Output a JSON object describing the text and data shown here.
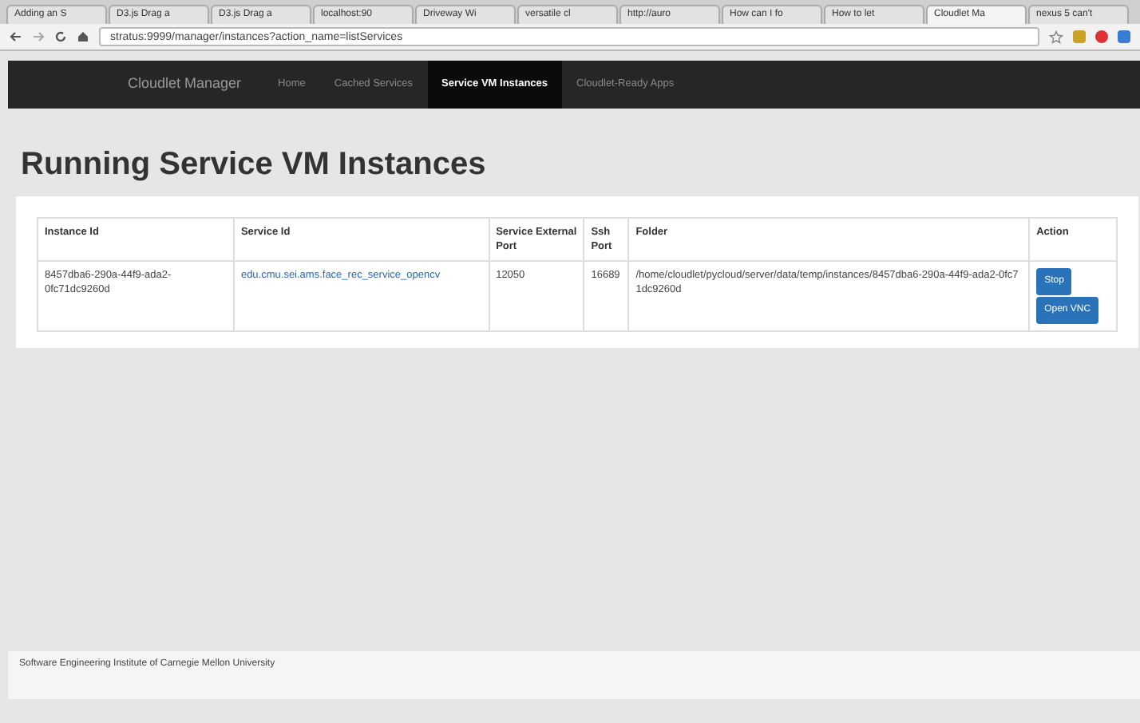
{
  "browser": {
    "tabs": [
      {
        "title": "Adding an S",
        "selected": false
      },
      {
        "title": "D3.js Drag a",
        "selected": false
      },
      {
        "title": "D3.js Drag a",
        "selected": false
      },
      {
        "title": "localhost:90",
        "selected": false
      },
      {
        "title": "Driveway Wi",
        "selected": false
      },
      {
        "title": "versatile cl",
        "selected": false
      },
      {
        "title": "http://auro",
        "selected": false
      },
      {
        "title": "How can I fo",
        "selected": false
      },
      {
        "title": "How to let",
        "selected": false
      },
      {
        "title": "Cloudlet Ma",
        "selected": true
      },
      {
        "title": "nexus 5 can't",
        "selected": false
      }
    ],
    "address": "stratus:9999/manager/instances?action_name=listServices"
  },
  "navbar": {
    "brand": "Cloudlet Manager",
    "items": [
      {
        "label": "Home",
        "selected": false
      },
      {
        "label": "Cached Services",
        "selected": false
      },
      {
        "label": "Service VM Instances",
        "selected": true
      },
      {
        "label": "Cloudlet-Ready Apps",
        "selected": false
      }
    ]
  },
  "heading": "Running Service VM Instances",
  "table": {
    "columns": [
      "Instance Id",
      "Service Id",
      "Service External Port",
      "Ssh Port",
      "Folder",
      "Action"
    ],
    "rows": [
      {
        "instance_id": "8457dba6-290a-44f9-ada2-0fc71dc9260d",
        "service_id": "edu.cmu.sei.ams.face_rec_service_opencv",
        "external_port": "12050",
        "ssh_port": "16689",
        "folder": "/home/cloudlet/pycloud/server/data/temp/instances/8457dba6-290a-44f9-ada2-0fc71dc9260d",
        "actions": [
          "Stop",
          "Open VNC"
        ]
      }
    ]
  },
  "footer": "Software Engineering Institute of Carnegie Mellon University"
}
